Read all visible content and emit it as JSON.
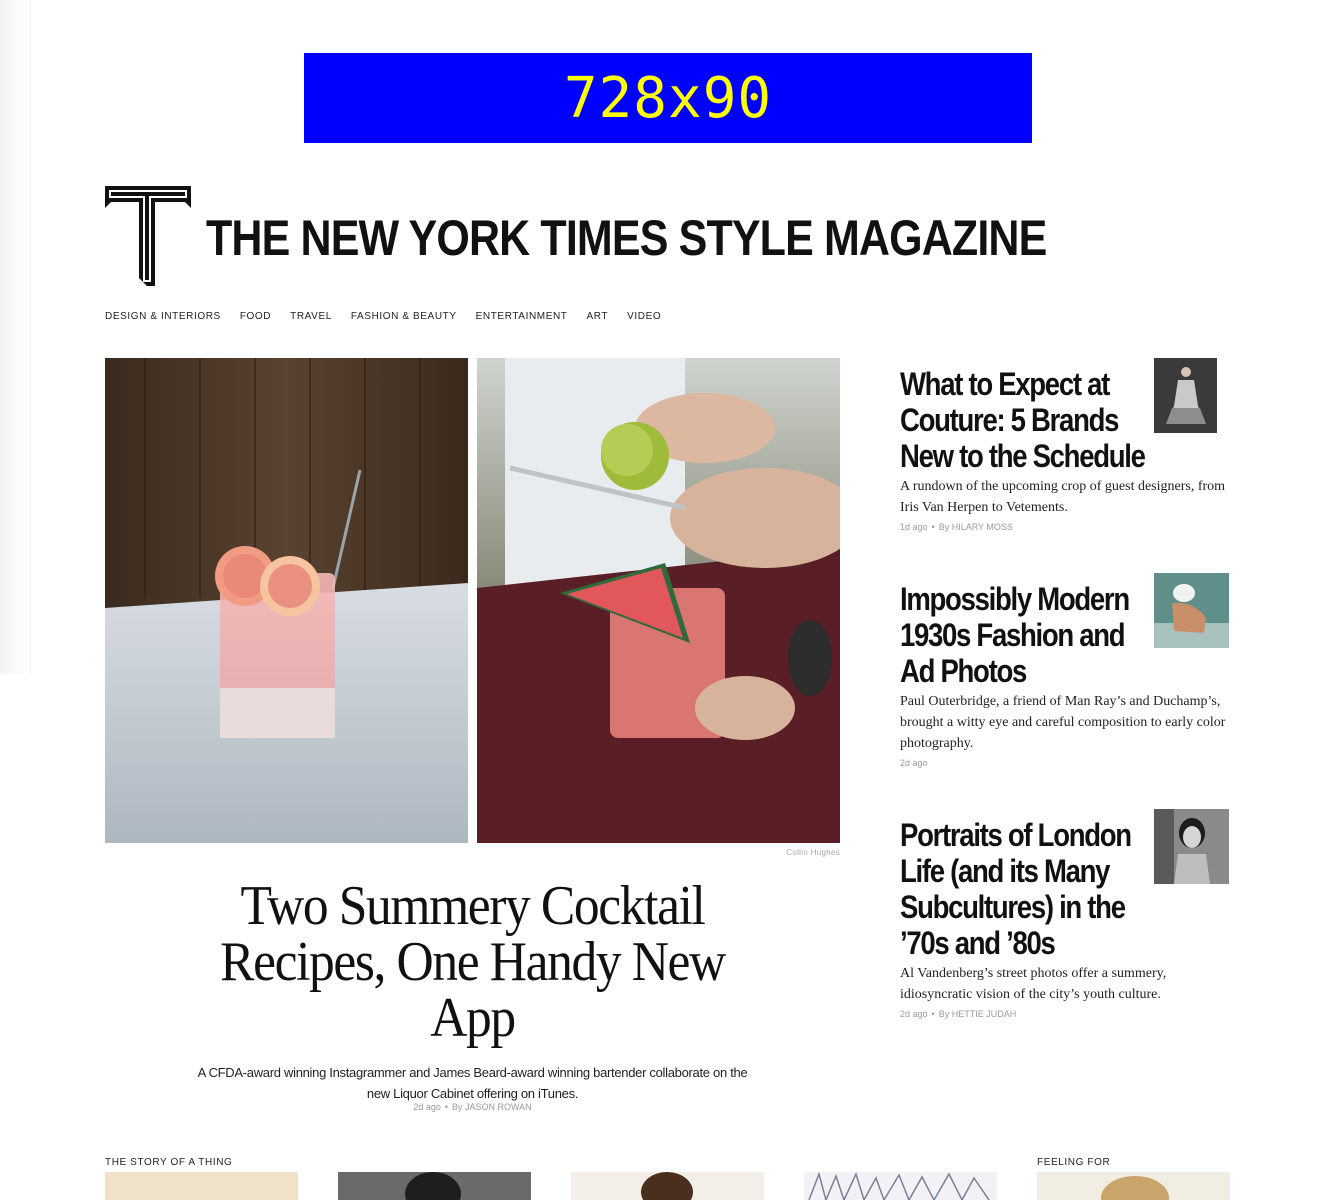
{
  "ad": {
    "label": "728x90"
  },
  "masthead": {
    "title": "THE NEW YORK TIMES STYLE MAGAZINE",
    "logo_icon": "t-magazine-logo-icon"
  },
  "nav": {
    "items": [
      {
        "label": "DESIGN & INTERIORS"
      },
      {
        "label": "FOOD"
      },
      {
        "label": "TRAVEL"
      },
      {
        "label": "FASHION & BEAUTY"
      },
      {
        "label": "ENTERTAINMENT"
      },
      {
        "label": "ART"
      },
      {
        "label": "VIDEO"
      }
    ]
  },
  "hero": {
    "credit": "Collin Hughes",
    "title": "Two Summery Cocktail Recipes, One Handy New App",
    "dek": "A CFDA-award winning Instagrammer and James Beard-award winning bartender collaborate on the new Liquor Cabinet offering on iTunes.",
    "age": "2d ago",
    "byline": "By JASON ROWAN"
  },
  "sidebar": [
    {
      "title_lines": [
        "What to Expect at",
        "Couture: 5 Brands",
        "New to the Schedule"
      ],
      "dek": "A rundown of the upcoming crop of guest designers, from Iris Van Herpen to Vetements.",
      "age": "1d ago",
      "byline": "By HILARY MOSS"
    },
    {
      "title_lines": [
        "Impossibly Modern",
        "1930s Fashion and",
        "Ad Photos"
      ],
      "dek": "Paul Outerbridge, a friend of Man Ray’s and Duchamp’s, brought a witty eye and careful composition to early color photography.",
      "age": "2d ago",
      "byline": ""
    },
    {
      "title_lines": [
        "Portraits of London",
        "Life (and its Many",
        "Subcultures) in the",
        "’70s and ’80s"
      ],
      "dek": "Al Vandenberg’s street photos offer a summery, idiosyncratic vision of the city’s youth culture.",
      "age": "2d ago",
      "byline": "By HETTIE JUDAH"
    }
  ],
  "bottom": {
    "left_label": "THE STORY OF A THING",
    "right_label": "FEELING FOR"
  },
  "colors": {
    "ad_bg": "#0000ff",
    "ad_text": "#ffff00",
    "meta": "#9a9a9a"
  }
}
